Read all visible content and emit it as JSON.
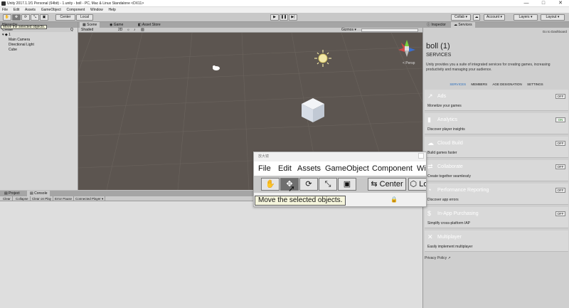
{
  "window": {
    "title": "Unity 2017.1.1f1 Personal (64bit) - 1.unity - boll - PC, Mac & Linux Standalone <DX11>",
    "minimize": "—",
    "maximize": "□",
    "close": "✕"
  },
  "menu": [
    "File",
    "Edit",
    "Assets",
    "GameObject",
    "Component",
    "Window",
    "Help"
  ],
  "toolbar": {
    "pivot_center": "Center",
    "pivot_local": "Local",
    "collab": "Collab ▾",
    "account": "Account ▾",
    "layers": "Layers ▾",
    "layout": "Layout ▾"
  },
  "hierarchy": {
    "tab": "Hierarchy",
    "create": "Create",
    "scene_root": "1",
    "items": [
      "Main Camera",
      "Directional Light",
      "Cube"
    ]
  },
  "scene": {
    "tabs": [
      "Scene",
      "Game",
      "Asset Store"
    ],
    "shading": "Shaded",
    "mode_2d": "2D",
    "gizmos": "Gizmos ▾",
    "persp": "< Persp"
  },
  "inspector": {
    "tabs": [
      "Inspector",
      "Services"
    ],
    "dashboard_link": "Go to Dashboard",
    "project_name": "boll (1)",
    "section_title": "SERVICES",
    "intro": "Unity provides you a suite of integrated services for creating games, increasing productivity and managing your audience.",
    "nav": [
      "SERVICES",
      "MEMBERS",
      "AGE DESIGNATION",
      "SETTINGS"
    ],
    "items": [
      {
        "name": "Ads",
        "desc": "Monetize your games",
        "toggle": "OFF",
        "icon": "ads-icon",
        "glyph": "↗"
      },
      {
        "name": "Analytics",
        "desc": "Discover player insights",
        "toggle": "ON",
        "icon": "analytics-icon",
        "glyph": "▮"
      },
      {
        "name": "Cloud Build",
        "desc": "Build games faster",
        "toggle": "OFF",
        "icon": "cloud-build-icon",
        "glyph": "☁"
      },
      {
        "name": "Collaborate",
        "desc": "Create together seamlessly",
        "toggle": "OFF",
        "icon": "collaborate-icon",
        "glyph": "⇄"
      },
      {
        "name": "Performance Reporting",
        "desc": "Discover app errors",
        "toggle": "OFF",
        "icon": "performance-icon",
        "glyph": "◔"
      },
      {
        "name": "In-App Purchasing",
        "desc": "Simplify cross-platform IAP",
        "toggle": "OFF",
        "icon": "iap-icon",
        "glyph": "$"
      },
      {
        "name": "Multiplayer",
        "desc": "Easily implement multiplayer",
        "toggle": "",
        "icon": "multiplayer-icon",
        "glyph": "✕"
      }
    ],
    "privacy": "Privacy Policy ↗"
  },
  "console": {
    "tabs": [
      "Project",
      "Console"
    ],
    "buttons": [
      "Clear",
      "Collapse",
      "Clear on Play",
      "Error Pause",
      "Connected Player ▾"
    ]
  },
  "tooltip_small": "Move the selected objects.",
  "zoom": {
    "title": "放大镜",
    "menu": [
      "File",
      "Edit",
      "Assets",
      "GameObject",
      "Component",
      "Wi"
    ],
    "center": "Center",
    "local": "Lo",
    "tooltip": "Move the selected objects."
  },
  "colors": {
    "scene_bg": "#5c5550",
    "active_tool": "#7b7b7b",
    "panel": "#cfcfcf"
  }
}
